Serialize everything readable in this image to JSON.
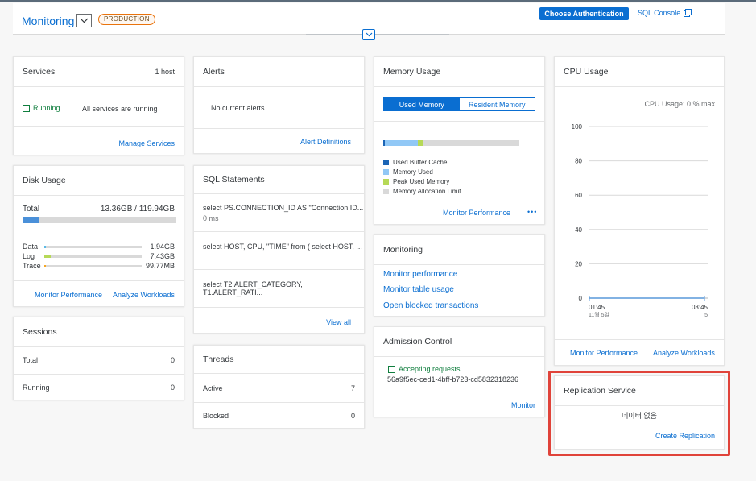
{
  "header": {
    "title": "Monitoring",
    "badge": "PRODUCTION",
    "choose_auth": "Choose Authentication",
    "sql_console": "SQL Console"
  },
  "services": {
    "title": "Services",
    "host_count": "1 host",
    "status": "Running",
    "status_text": "All services are running",
    "link": "Manage Services"
  },
  "alerts": {
    "title": "Alerts",
    "message": "No current alerts",
    "link": "Alert Definitions"
  },
  "memory": {
    "title": "Memory Usage",
    "tab_used": "Used Memory",
    "tab_resident": "Resident Memory",
    "legend": [
      "Used Buffer Cache",
      "Memory Used",
      "Peak Used Memory",
      "Memory Allocation Limit"
    ],
    "link": "Monitor Performance",
    "more": "•••",
    "bar_fractions": {
      "buffer": 0.012,
      "used": 0.24,
      "peak": 0.045
    }
  },
  "cpu": {
    "title": "CPU Usage",
    "max_label": "CPU Usage: 0 % max",
    "link_perf": "Monitor Performance",
    "link_workloads": "Analyze Workloads"
  },
  "chart_data": {
    "type": "line",
    "title": "",
    "ylim": [
      0,
      100
    ],
    "yticks": [
      "100",
      "80",
      "60",
      "40",
      "20",
      "0"
    ],
    "x_start": [
      "01:45",
      "11월 5일"
    ],
    "x_end": [
      "03:45",
      "5"
    ],
    "series": [
      {
        "values": [
          0,
          0
        ]
      }
    ]
  },
  "disk": {
    "title": "Disk Usage",
    "total_label": "Total",
    "total_value": "13.36GB / 119.94GB",
    "total_fraction": 0.111,
    "rows": [
      {
        "label": "Data",
        "value": "1.94GB",
        "fraction": 0.016,
        "color": "#5cbae6"
      },
      {
        "label": "Log",
        "value": "7.43GB",
        "fraction": 0.062,
        "color": "#b6d957"
      },
      {
        "label": "Trace",
        "value": "99.77MB",
        "fraction": 0.01,
        "color": "#f5a623"
      }
    ],
    "link_perf": "Monitor Performance",
    "link_workloads": "Analyze Workloads"
  },
  "sql": {
    "title": "SQL Statements",
    "items": [
      {
        "text": "select PS.CONNECTION_ID AS \"Connection ID...",
        "sub": "0 ms"
      },
      {
        "text": "select HOST, CPU, \"TIME\" from ( select HOST, ..."
      },
      {
        "text": "select T2.ALERT_CATEGORY, T1.ALERT_RATI..."
      }
    ],
    "link": "View all"
  },
  "monitoring": {
    "title": "Monitoring",
    "links": [
      "Monitor performance",
      "Monitor table usage",
      "Open blocked transactions"
    ]
  },
  "admission": {
    "title": "Admission Control",
    "status": "Accepting requests",
    "id": "56a9f5ec-ced1-4bff-b723-cd5832318236",
    "link": "Monitor"
  },
  "replication": {
    "title": "Replication Service",
    "empty": "데이터 없음",
    "link": "Create Replication"
  },
  "sessions": {
    "title": "Sessions",
    "rows": [
      {
        "label": "Total",
        "value": "0"
      },
      {
        "label": "Running",
        "value": "0"
      }
    ]
  },
  "threads": {
    "title": "Threads",
    "rows": [
      {
        "label": "Active",
        "value": "7"
      },
      {
        "label": "Blocked",
        "value": "0"
      }
    ]
  },
  "colors": {
    "accent": "#0a6ed1",
    "buffer_cache": "#1b65b6",
    "memory_used": "#91c8f6",
    "peak_used": "#b6d957",
    "limit": "#d9d9d9",
    "highlight": "#e0433a"
  }
}
